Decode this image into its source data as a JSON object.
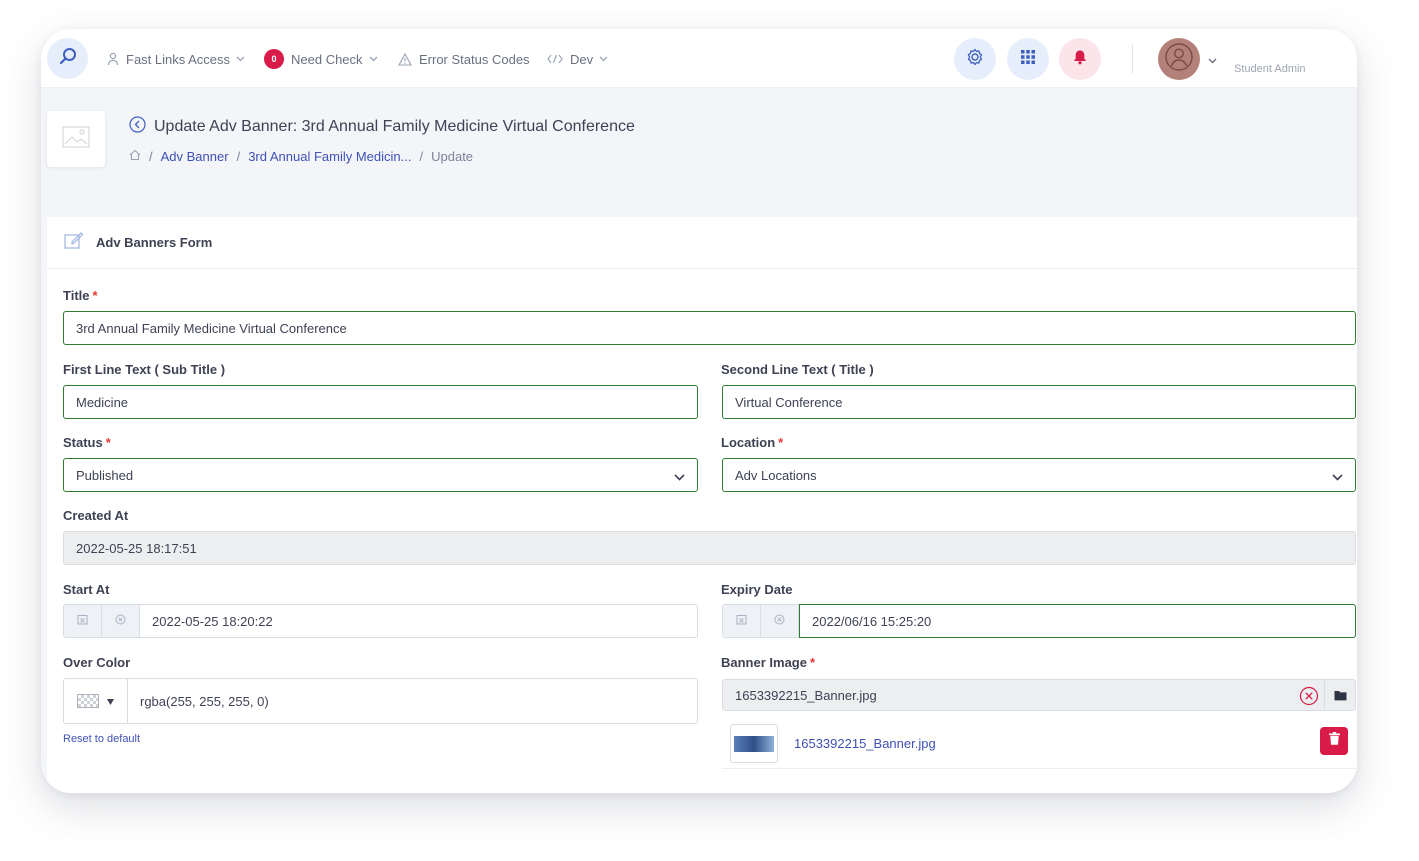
{
  "topbar": {
    "nav": [
      {
        "label": "Fast Links Access",
        "icon": "person-icon"
      },
      {
        "label": "Need Check",
        "icon": "badge",
        "badge": "0"
      },
      {
        "label": "Error Status Codes",
        "icon": "warning-icon"
      },
      {
        "label": "Dev",
        "icon": "code-icon"
      }
    ],
    "user_name": "Student Admin"
  },
  "header": {
    "title": "Update Adv Banner: 3rd Annual Family Medicine Virtual Conference",
    "breadcrumb": [
      "Adv Banner",
      "3rd Annual Family Medicin...",
      "Update"
    ]
  },
  "form": {
    "card_title": "Adv Banners Form",
    "required_mark": "*",
    "title": {
      "label": "Title",
      "value": "3rd Annual Family Medicine Virtual Conference"
    },
    "first_line": {
      "label": "First Line Text ( Sub Title )",
      "value": "Medicine"
    },
    "second_line": {
      "label": "Second Line Text ( Title )",
      "value": "Virtual Conference"
    },
    "status": {
      "label": "Status",
      "value": "Published"
    },
    "location": {
      "label": "Location",
      "value": "Adv Locations"
    },
    "created_at": {
      "label": "Created At",
      "value": "2022-05-25 18:17:51"
    },
    "start_at": {
      "label": "Start At",
      "value": "2022-05-25 18:20:22"
    },
    "expiry_date": {
      "label": "Expiry Date",
      "value": "2022/06/16 15:25:20"
    },
    "over_color": {
      "label": "Over Color",
      "value": "rgba(255, 255, 255, 0)",
      "reset_label": "Reset to default"
    },
    "banner_image": {
      "label": "Banner Image",
      "value": "1653392215_Banner.jpg",
      "file_link": "1653392215_Banner.jpg"
    }
  },
  "colors": {
    "accent": "#3f51b5",
    "danger": "#d81b48",
    "valid_border": "#2e7d32"
  }
}
